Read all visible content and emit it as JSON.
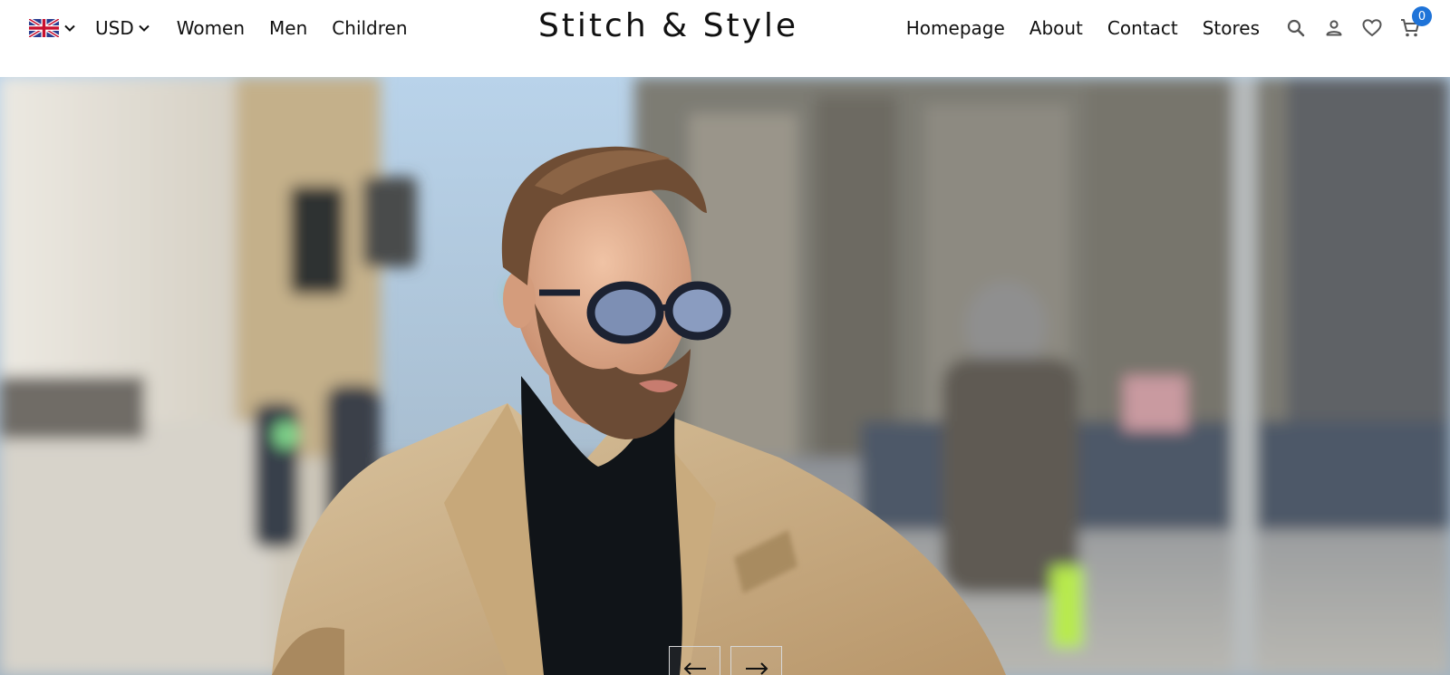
{
  "header": {
    "language": {
      "flag_icon": "uk-flag-icon",
      "dropdown_icon": "chevron-down-icon"
    },
    "currency": {
      "label": "USD",
      "dropdown_icon": "chevron-down-icon"
    },
    "left_links": [
      "Women",
      "Men",
      "Children"
    ],
    "brand": "Stitch & Style",
    "right_links": [
      "Homepage",
      "About",
      "Contact",
      "Stores"
    ],
    "icons": {
      "search": "search-icon",
      "account": "user-icon",
      "wishlist": "heart-icon",
      "cart": "cart-icon"
    },
    "cart_count": "0"
  },
  "hero": {
    "image": "man-in-camel-coat-and-glasses-street-photo",
    "controls": {
      "prev_icon": "arrow-left-icon",
      "next_icon": "arrow-right-icon"
    }
  },
  "colors": {
    "badge": "#1e73d8",
    "text": "#111111",
    "background": "#ffffff"
  }
}
